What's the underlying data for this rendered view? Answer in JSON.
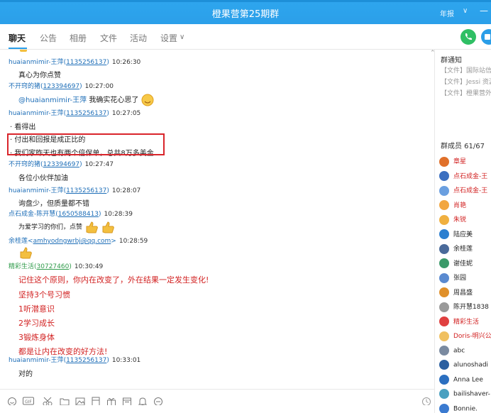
{
  "window": {
    "title": "橙果营第25期群",
    "user": "年报"
  },
  "tabs": [
    {
      "label": "聊天",
      "active": true
    },
    {
      "label": "公告"
    },
    {
      "label": "相册"
    },
    {
      "label": "文件"
    },
    {
      "label": "活动"
    },
    {
      "label": "设置"
    }
  ],
  "messages": [
    {
      "sender": "huaianmimir-王萍",
      "qq": "1135256137",
      "time": "10:26:30",
      "text": "真心为你点赞"
    },
    {
      "sender": "不开窍的猪",
      "qq": "123394697",
      "time": "10:27:00",
      "mention": "@huaianmimir-王萍",
      "text": "我确实花心思了"
    },
    {
      "sender": "huaianmimir-王萍",
      "qq": "1135256137",
      "time": "10:27:05",
      "lines": [
        "看得出",
        "付出和回报是成正比的",
        "我们家昨天也有两个倍保单，总共8万多美金"
      ]
    },
    {
      "sender": "不开窍的猪",
      "qq": "123394697",
      "time": "10:27:47",
      "text": "各位小伙伴加油"
    },
    {
      "sender": "huaianmimir-王萍",
      "qq": "1135256137",
      "time": "10:28:07",
      "text": "询盘少，但质量都不错"
    },
    {
      "sender": "点石成金-陈开慧",
      "qq": "1650588413",
      "time": "10:28:39",
      "text": "为爱学习的你们，点赞"
    },
    {
      "sender": "余桂莲",
      "email": "amhyodngwrbj@qq.com",
      "time": "10:28:59"
    },
    {
      "sender": "精彩生活",
      "qq": "30727460",
      "time": "10:30:49",
      "lines": [
        "记住这个原则，你内在改变了，外在结果一定发生变化!",
        "坚持3个号习惯",
        "1听潜意识",
        "2学习成长",
        "3锻炼身体",
        "都是让内在改变的好方法!"
      ]
    },
    {
      "sender": "huaianmimir-王萍",
      "qq": "1135256137",
      "time": "10:33:01",
      "text": "对的"
    }
  ],
  "side": {
    "notice_title": "群通知",
    "files": [
      "【文件】国际站信",
      "【文件】Jessi 资源",
      "【文件】橙果营外"
    ],
    "members_title": "群成员 61/67",
    "members": [
      {
        "name": "章星",
        "color": "#e0702a",
        "red": true
      },
      {
        "name": "点石成金-王",
        "color": "#3b6fc0",
        "red": true
      },
      {
        "name": "点石成金-王",
        "color": "#6a9fe0",
        "red": true
      },
      {
        "name": "肖艳",
        "color": "#f2a640",
        "red": true
      },
      {
        "name": "朱锐",
        "color": "#f0b040",
        "red": true
      },
      {
        "name": "陆应美",
        "color": "#2b7fd0"
      },
      {
        "name": "余桂莲",
        "color": "#4a6a9a"
      },
      {
        "name": "谢佳妮",
        "color": "#3b9a6a"
      },
      {
        "name": "张园",
        "color": "#5a8ad0"
      },
      {
        "name": "周昌盛",
        "color": "#e0902a"
      },
      {
        "name": "陈开慧1838",
        "color": "#9a9a9a"
      },
      {
        "name": "精彩生活",
        "color": "#e04040",
        "red": true
      },
      {
        "name": "Doris-明兴公",
        "color": "#f0c060",
        "red": true
      },
      {
        "name": "abc",
        "color": "#7a8aa0"
      },
      {
        "name": "alunoshadi",
        "color": "#2b5fa0"
      },
      {
        "name": "Anna Lee",
        "color": "#2b6fc0"
      },
      {
        "name": "bailishaver-",
        "color": "#4aa0c0"
      },
      {
        "name": "Bonnie.",
        "color": "#3a7ad0"
      }
    ]
  },
  "colors": {
    "titlebar": "#2ea6ee",
    "link": "#1f6fb8",
    "highlight": "#d9252b"
  }
}
